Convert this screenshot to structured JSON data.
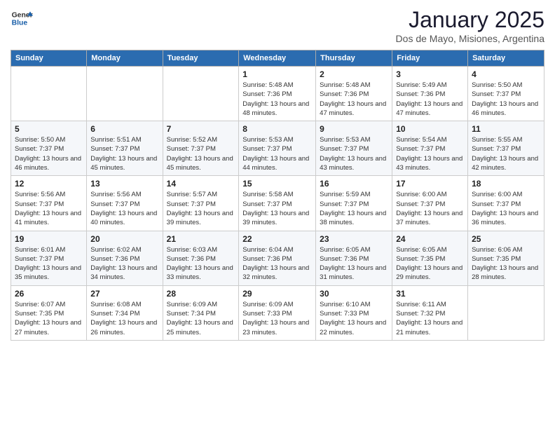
{
  "header": {
    "logo_general": "General",
    "logo_blue": "Blue",
    "month_title": "January 2025",
    "subtitle": "Dos de Mayo, Misiones, Argentina"
  },
  "weekdays": [
    "Sunday",
    "Monday",
    "Tuesday",
    "Wednesday",
    "Thursday",
    "Friday",
    "Saturday"
  ],
  "weeks": [
    [
      {
        "day": "",
        "sunrise": "",
        "sunset": "",
        "daylight": ""
      },
      {
        "day": "",
        "sunrise": "",
        "sunset": "",
        "daylight": ""
      },
      {
        "day": "",
        "sunrise": "",
        "sunset": "",
        "daylight": ""
      },
      {
        "day": "1",
        "sunrise": "Sunrise: 5:48 AM",
        "sunset": "Sunset: 7:36 PM",
        "daylight": "Daylight: 13 hours and 48 minutes."
      },
      {
        "day": "2",
        "sunrise": "Sunrise: 5:48 AM",
        "sunset": "Sunset: 7:36 PM",
        "daylight": "Daylight: 13 hours and 47 minutes."
      },
      {
        "day": "3",
        "sunrise": "Sunrise: 5:49 AM",
        "sunset": "Sunset: 7:36 PM",
        "daylight": "Daylight: 13 hours and 47 minutes."
      },
      {
        "day": "4",
        "sunrise": "Sunrise: 5:50 AM",
        "sunset": "Sunset: 7:37 PM",
        "daylight": "Daylight: 13 hours and 46 minutes."
      }
    ],
    [
      {
        "day": "5",
        "sunrise": "Sunrise: 5:50 AM",
        "sunset": "Sunset: 7:37 PM",
        "daylight": "Daylight: 13 hours and 46 minutes."
      },
      {
        "day": "6",
        "sunrise": "Sunrise: 5:51 AM",
        "sunset": "Sunset: 7:37 PM",
        "daylight": "Daylight: 13 hours and 45 minutes."
      },
      {
        "day": "7",
        "sunrise": "Sunrise: 5:52 AM",
        "sunset": "Sunset: 7:37 PM",
        "daylight": "Daylight: 13 hours and 45 minutes."
      },
      {
        "day": "8",
        "sunrise": "Sunrise: 5:53 AM",
        "sunset": "Sunset: 7:37 PM",
        "daylight": "Daylight: 13 hours and 44 minutes."
      },
      {
        "day": "9",
        "sunrise": "Sunrise: 5:53 AM",
        "sunset": "Sunset: 7:37 PM",
        "daylight": "Daylight: 13 hours and 43 minutes."
      },
      {
        "day": "10",
        "sunrise": "Sunrise: 5:54 AM",
        "sunset": "Sunset: 7:37 PM",
        "daylight": "Daylight: 13 hours and 43 minutes."
      },
      {
        "day": "11",
        "sunrise": "Sunrise: 5:55 AM",
        "sunset": "Sunset: 7:37 PM",
        "daylight": "Daylight: 13 hours and 42 minutes."
      }
    ],
    [
      {
        "day": "12",
        "sunrise": "Sunrise: 5:56 AM",
        "sunset": "Sunset: 7:37 PM",
        "daylight": "Daylight: 13 hours and 41 minutes."
      },
      {
        "day": "13",
        "sunrise": "Sunrise: 5:56 AM",
        "sunset": "Sunset: 7:37 PM",
        "daylight": "Daylight: 13 hours and 40 minutes."
      },
      {
        "day": "14",
        "sunrise": "Sunrise: 5:57 AM",
        "sunset": "Sunset: 7:37 PM",
        "daylight": "Daylight: 13 hours and 39 minutes."
      },
      {
        "day": "15",
        "sunrise": "Sunrise: 5:58 AM",
        "sunset": "Sunset: 7:37 PM",
        "daylight": "Daylight: 13 hours and 39 minutes."
      },
      {
        "day": "16",
        "sunrise": "Sunrise: 5:59 AM",
        "sunset": "Sunset: 7:37 PM",
        "daylight": "Daylight: 13 hours and 38 minutes."
      },
      {
        "day": "17",
        "sunrise": "Sunrise: 6:00 AM",
        "sunset": "Sunset: 7:37 PM",
        "daylight": "Daylight: 13 hours and 37 minutes."
      },
      {
        "day": "18",
        "sunrise": "Sunrise: 6:00 AM",
        "sunset": "Sunset: 7:37 PM",
        "daylight": "Daylight: 13 hours and 36 minutes."
      }
    ],
    [
      {
        "day": "19",
        "sunrise": "Sunrise: 6:01 AM",
        "sunset": "Sunset: 7:37 PM",
        "daylight": "Daylight: 13 hours and 35 minutes."
      },
      {
        "day": "20",
        "sunrise": "Sunrise: 6:02 AM",
        "sunset": "Sunset: 7:36 PM",
        "daylight": "Daylight: 13 hours and 34 minutes."
      },
      {
        "day": "21",
        "sunrise": "Sunrise: 6:03 AM",
        "sunset": "Sunset: 7:36 PM",
        "daylight": "Daylight: 13 hours and 33 minutes."
      },
      {
        "day": "22",
        "sunrise": "Sunrise: 6:04 AM",
        "sunset": "Sunset: 7:36 PM",
        "daylight": "Daylight: 13 hours and 32 minutes."
      },
      {
        "day": "23",
        "sunrise": "Sunrise: 6:05 AM",
        "sunset": "Sunset: 7:36 PM",
        "daylight": "Daylight: 13 hours and 31 minutes."
      },
      {
        "day": "24",
        "sunrise": "Sunrise: 6:05 AM",
        "sunset": "Sunset: 7:35 PM",
        "daylight": "Daylight: 13 hours and 29 minutes."
      },
      {
        "day": "25",
        "sunrise": "Sunrise: 6:06 AM",
        "sunset": "Sunset: 7:35 PM",
        "daylight": "Daylight: 13 hours and 28 minutes."
      }
    ],
    [
      {
        "day": "26",
        "sunrise": "Sunrise: 6:07 AM",
        "sunset": "Sunset: 7:35 PM",
        "daylight": "Daylight: 13 hours and 27 minutes."
      },
      {
        "day": "27",
        "sunrise": "Sunrise: 6:08 AM",
        "sunset": "Sunset: 7:34 PM",
        "daylight": "Daylight: 13 hours and 26 minutes."
      },
      {
        "day": "28",
        "sunrise": "Sunrise: 6:09 AM",
        "sunset": "Sunset: 7:34 PM",
        "daylight": "Daylight: 13 hours and 25 minutes."
      },
      {
        "day": "29",
        "sunrise": "Sunrise: 6:09 AM",
        "sunset": "Sunset: 7:33 PM",
        "daylight": "Daylight: 13 hours and 23 minutes."
      },
      {
        "day": "30",
        "sunrise": "Sunrise: 6:10 AM",
        "sunset": "Sunset: 7:33 PM",
        "daylight": "Daylight: 13 hours and 22 minutes."
      },
      {
        "day": "31",
        "sunrise": "Sunrise: 6:11 AM",
        "sunset": "Sunset: 7:32 PM",
        "daylight": "Daylight: 13 hours and 21 minutes."
      },
      {
        "day": "",
        "sunrise": "",
        "sunset": "",
        "daylight": ""
      }
    ]
  ]
}
